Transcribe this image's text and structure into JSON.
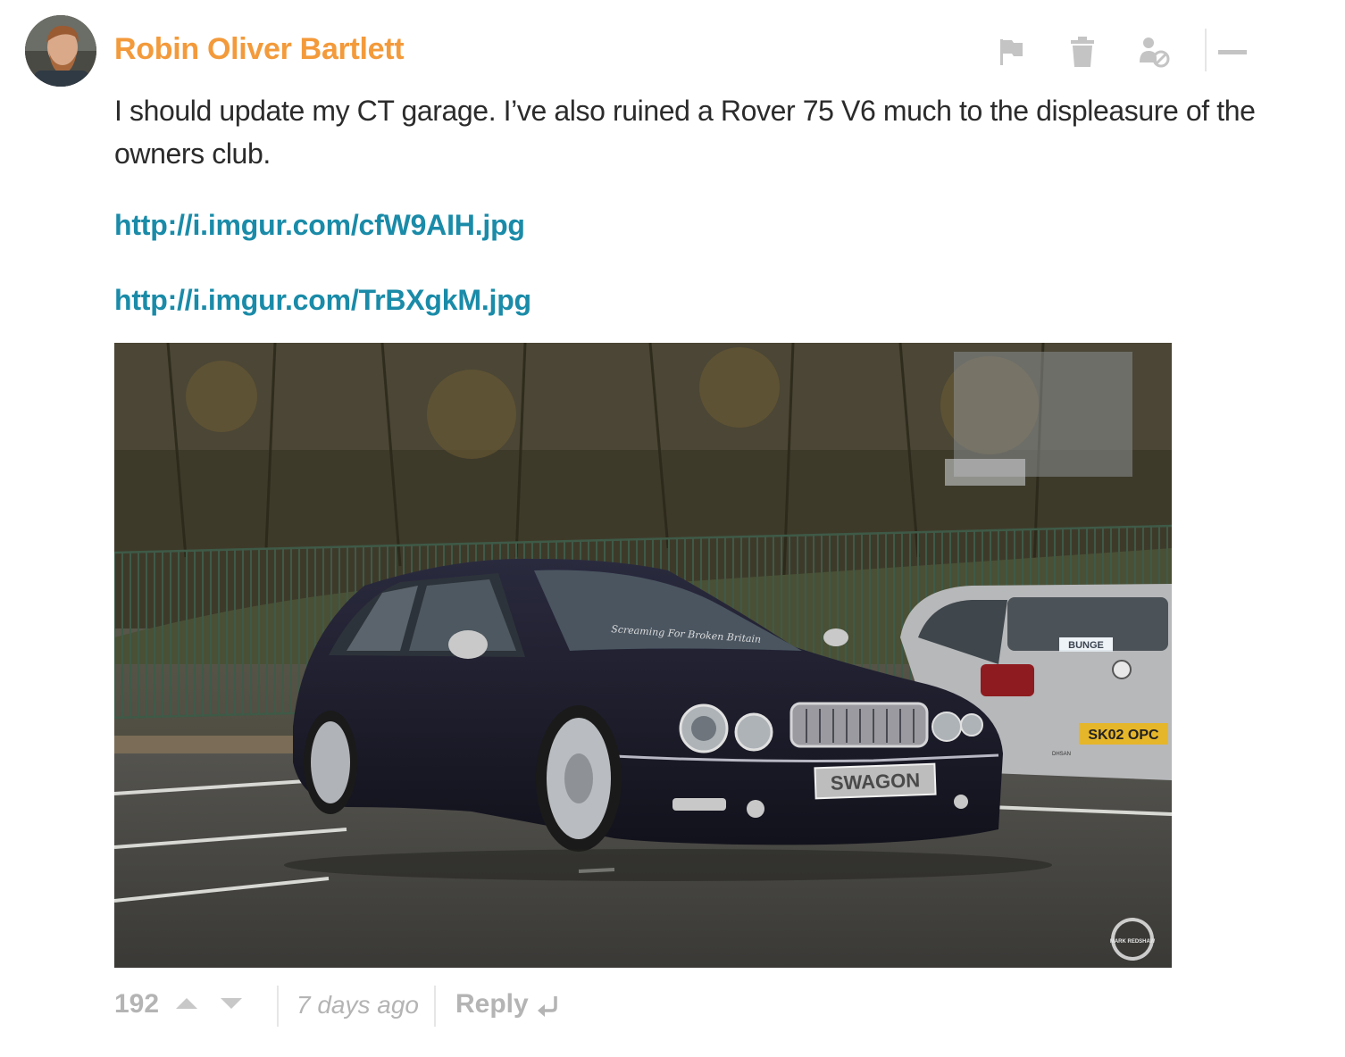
{
  "comment": {
    "author": "Robin Oliver Bartlett",
    "author_color": "#f39a3b",
    "body": "I should update my CT garage. I’ve also ruined a Rover 75 V6 much to the displeasure of the owners club.",
    "links": [
      "http://i.imgur.com/cfW9AIH.jpg",
      "http://i.imgur.com/TrBXgkM.jpg"
    ],
    "link_color": "#1a8ba8",
    "image": {
      "sticker_text": "Screaming For Broken Britain",
      "front_plate": "SWAGON",
      "rear_plate": "SK02 OPC",
      "rear_plate_2": "BUNGE",
      "watermark": "MARK REDSHAW",
      "dealer_badge": "DHSAN"
    }
  },
  "actions": {
    "icons": [
      "flag-icon",
      "trash-icon",
      "block-user-icon",
      "collapse-icon"
    ]
  },
  "footer": {
    "vote_count": "192",
    "timestamp": "7 days ago",
    "reply_label": "Reply"
  }
}
